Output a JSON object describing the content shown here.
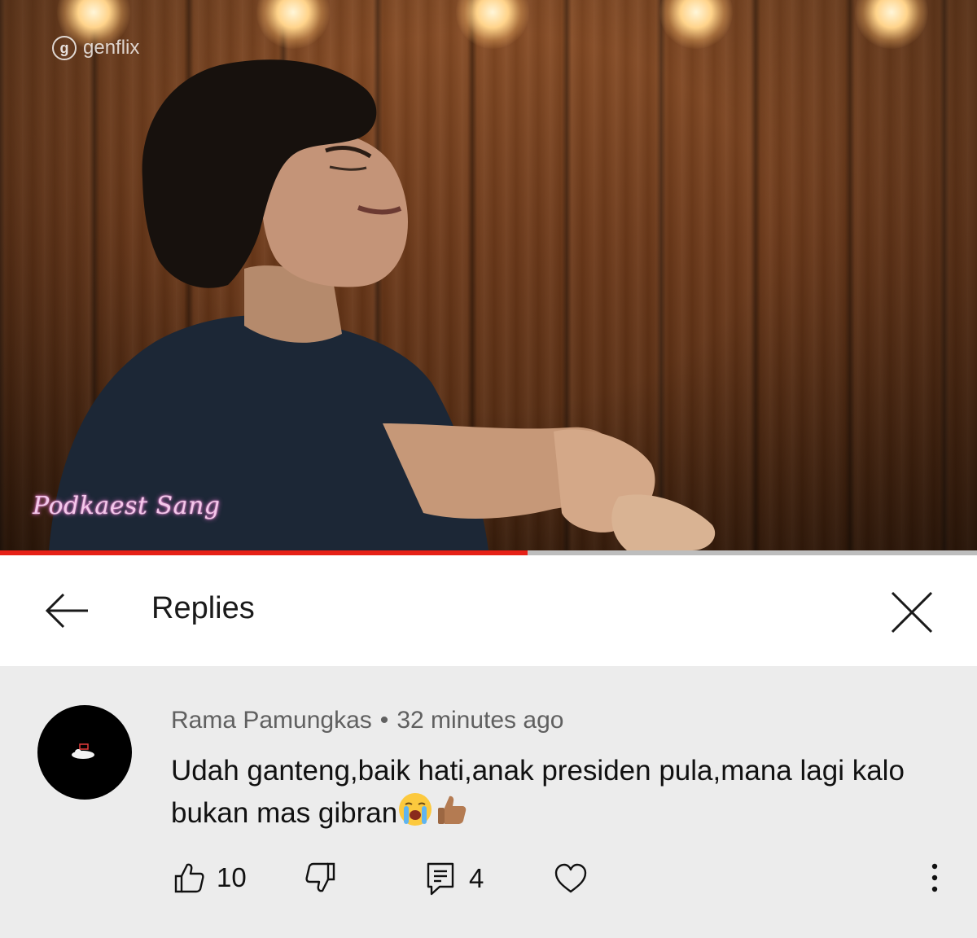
{
  "video": {
    "brand_glyph": "g",
    "brand_name": "genflix",
    "watermark": "Podkaest Sang",
    "progress_fraction": 0.54,
    "progress_color": "#e62117"
  },
  "header": {
    "title": "Replies",
    "back_icon": "arrow-left-icon",
    "close_icon": "close-icon"
  },
  "comment": {
    "author": "Rama Pamungkas",
    "separator": "•",
    "time": "32 minutes ago",
    "text": "Udah ganteng,baik hati,anak presiden pula,mana lagi kalo bukan mas gibran",
    "emojis": [
      "loudly-crying-face",
      "thumbs-up-medium-dark"
    ],
    "likes": "10",
    "replies": "4",
    "avatar_color": "#000000"
  },
  "actions": {
    "like_icon": "thumbs-up-icon",
    "dislike_icon": "thumbs-down-icon",
    "reply_icon": "reply-comment-icon",
    "heart_icon": "heart-icon",
    "more_icon": "more-vertical-icon"
  }
}
